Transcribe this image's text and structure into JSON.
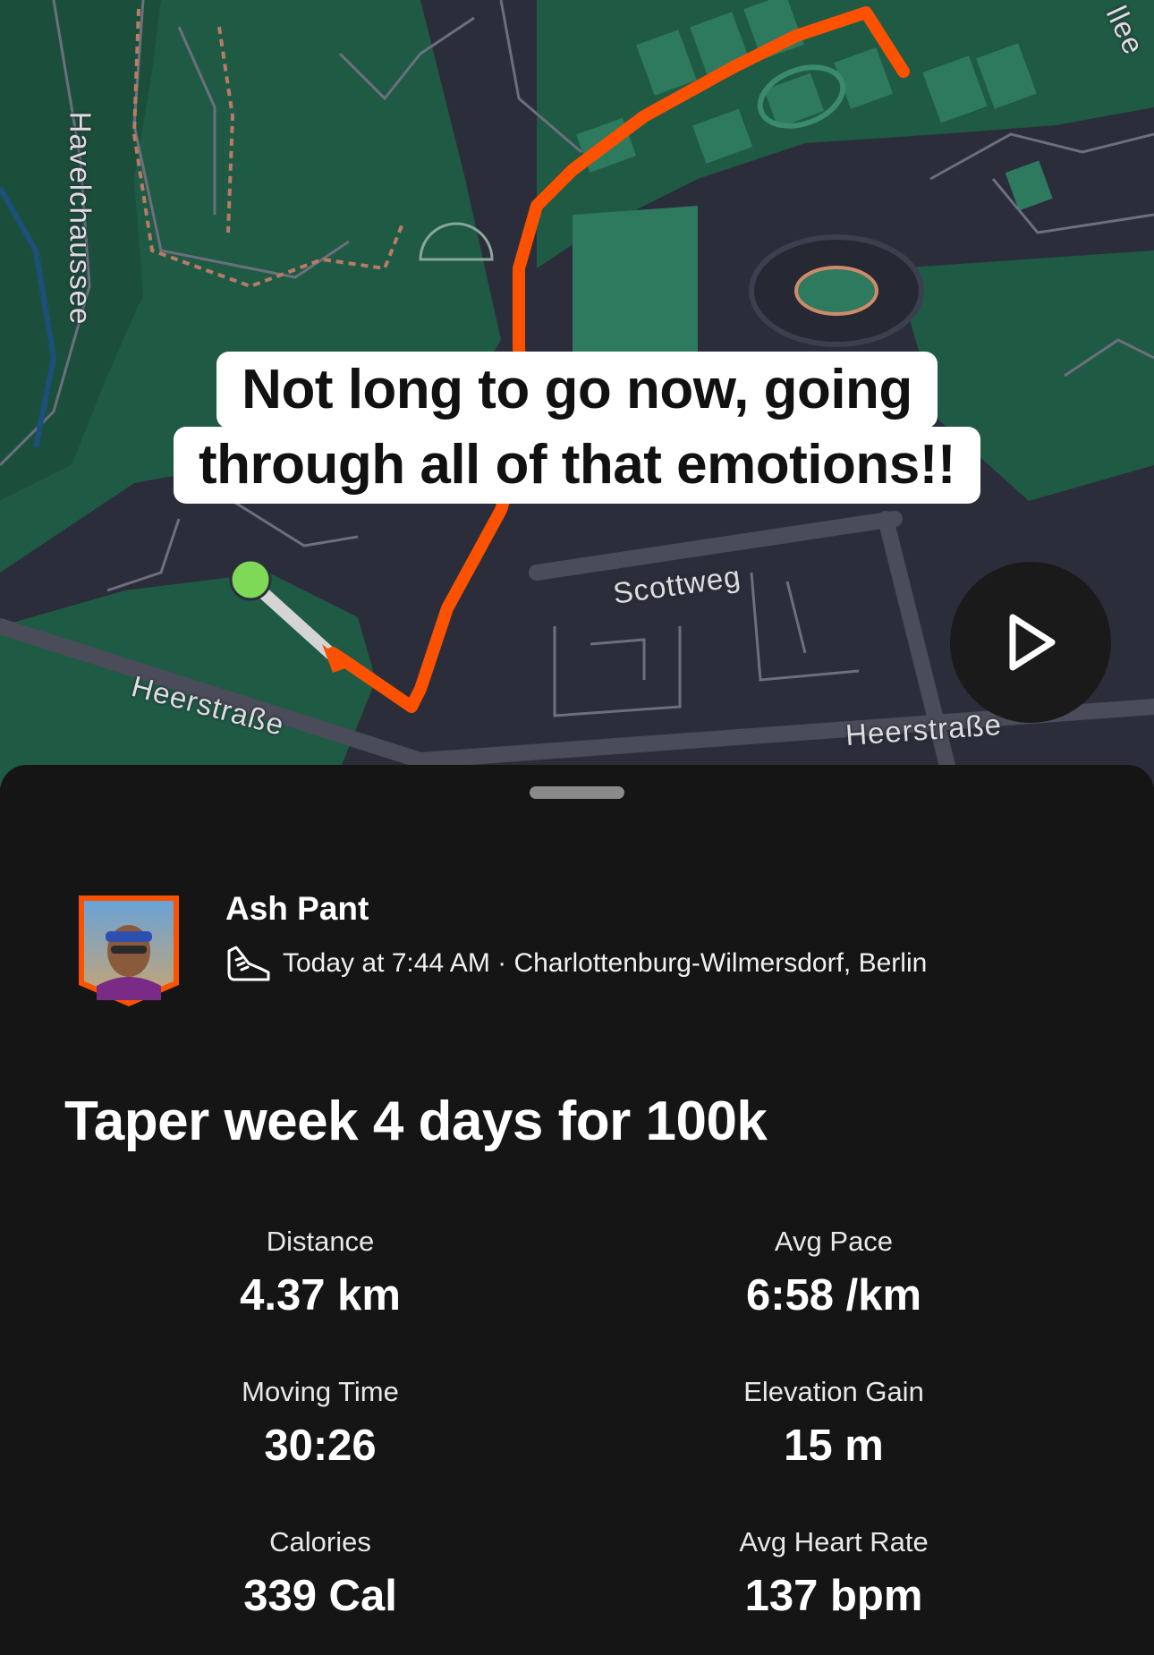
{
  "map": {
    "caption_line1": "Not long to go now, going",
    "caption_line2": "through all of that emotions!!",
    "labels": {
      "havelchaussee": "Havelchaussee",
      "scottweg": "Scottweg",
      "heerstrasse_left": "Heerstraße",
      "heerstrasse_right": "Heerstraße",
      "allee": "llee"
    },
    "colors": {
      "route": "#fc5200",
      "start_marker": "#7ed957",
      "park": "#1f5a45",
      "building": "#2e7a5f",
      "background": "#2b2d3a"
    },
    "play_icon": "play-icon"
  },
  "activity": {
    "athlete_name": "Ash Pant",
    "meta": "Today at 7:44 AM · Charlottenburg-Wilmersdorf, Berlin",
    "sport_icon": "running-shoe-icon",
    "title": "Taper week 4 days for 100k"
  },
  "stats": [
    {
      "label": "Distance",
      "value": "4.37 km"
    },
    {
      "label": "Avg Pace",
      "value": "6:58 /km"
    },
    {
      "label": "Moving Time",
      "value": "30:26"
    },
    {
      "label": "Elevation Gain",
      "value": "15 m"
    },
    {
      "label": "Calories",
      "value": "339 Cal"
    },
    {
      "label": "Avg Heart Rate",
      "value": "137 bpm"
    }
  ]
}
